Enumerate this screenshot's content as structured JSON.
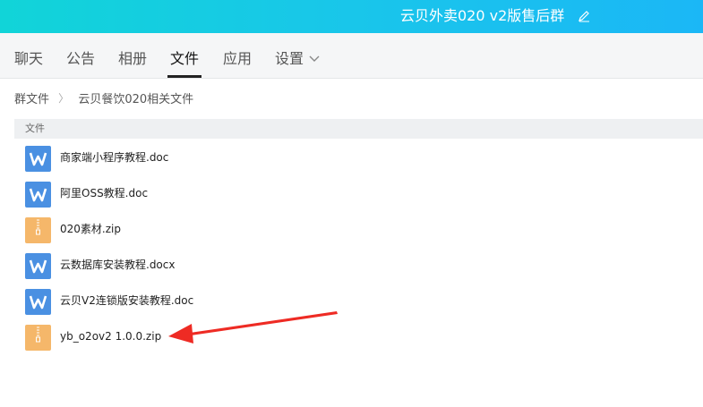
{
  "window": {
    "title": "云贝外卖020 v2版售后群",
    "edit_icon": "pencil-icon"
  },
  "tabs": [
    {
      "label": "聊天",
      "active": false
    },
    {
      "label": "公告",
      "active": false
    },
    {
      "label": "相册",
      "active": false
    },
    {
      "label": "文件",
      "active": true
    },
    {
      "label": "应用",
      "active": false
    },
    {
      "label": "设置",
      "active": false
    }
  ],
  "breadcrumb": {
    "root": "群文件",
    "separator": "〉",
    "current": "云贝餐饮020相关文件"
  },
  "list": {
    "header": "文件"
  },
  "files": [
    {
      "name": "商家端小程序教程.doc",
      "icon": "word-doc-icon"
    },
    {
      "name": "阿里OSS教程.doc",
      "icon": "word-doc-icon"
    },
    {
      "name": "020素材.zip",
      "icon": "zip-archive-icon"
    },
    {
      "name": "云数据库安装教程.docx",
      "icon": "word-doc-icon"
    },
    {
      "name": "云贝V2连锁版安装教程.doc",
      "icon": "word-doc-icon"
    },
    {
      "name": "yb_o2ov2 1.0.0.zip",
      "icon": "zip-archive-icon"
    }
  ],
  "colors": {
    "accent_gradient_start": "#11d4d8",
    "accent_gradient_end": "#1bb7f6",
    "annotation_arrow": "#ee2b24"
  }
}
